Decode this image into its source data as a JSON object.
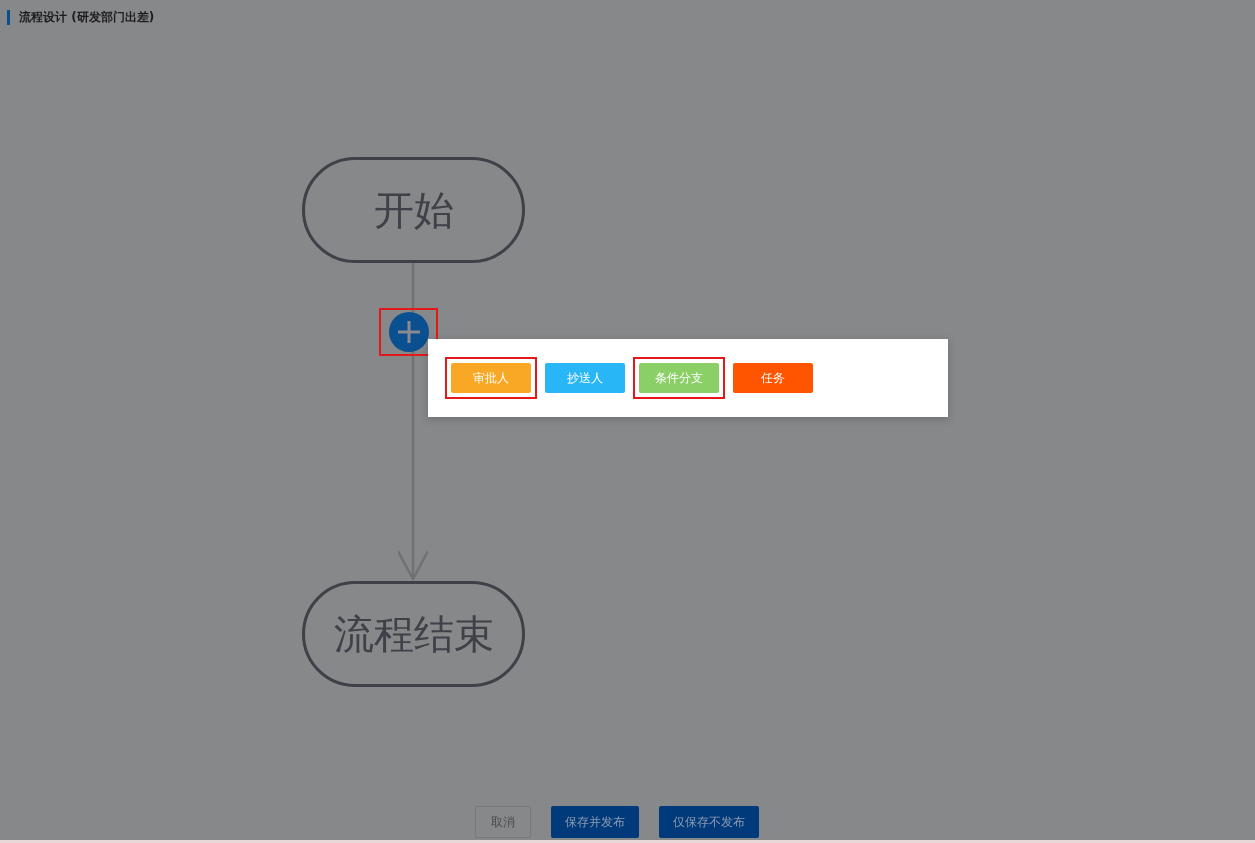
{
  "header": {
    "title": "流程设计 (研发部门出差)"
  },
  "flow": {
    "nodes": [
      {
        "kind": "start",
        "label": "开始"
      },
      {
        "kind": "end",
        "label": "流程结束"
      }
    ],
    "add_button": {
      "highlighted": true
    }
  },
  "add_menu": {
    "options": [
      {
        "label": "审批人",
        "color": "#f9a825",
        "highlighted": true
      },
      {
        "label": "抄送人",
        "color": "#29b6f6",
        "highlighted": false
      },
      {
        "label": "条件分支",
        "color": "#8bcf67",
        "highlighted": true
      },
      {
        "label": "任务",
        "color": "#ff5500",
        "highlighted": false
      }
    ]
  },
  "footer": {
    "buttons": [
      {
        "label": "取消",
        "kind": "cancel"
      },
      {
        "label": "保存并发布",
        "kind": "primary"
      },
      {
        "label": "仅保存不发布",
        "kind": "primary"
      }
    ]
  }
}
